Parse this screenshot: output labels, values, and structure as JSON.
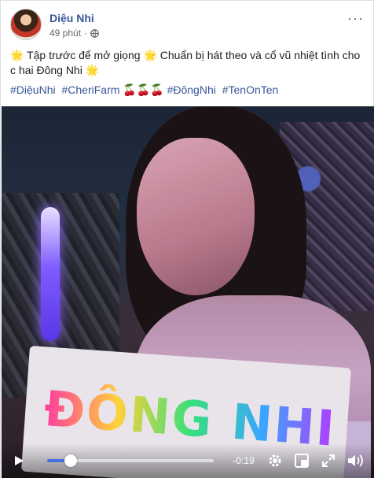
{
  "post": {
    "author": "Diệu Nhi",
    "time": "49 phút",
    "privacy_icon": "globe-icon",
    "more_label": "···",
    "text_line1": "Tập trước để mở giọng",
    "text_line2": "Chuẩn bị hát theo và cổ vũ nhiệt tình cho",
    "text_line3": "c hai Đông Nhi",
    "emoji_sun": "🌟",
    "hashtags": [
      "#DiệuNhi",
      "#CheriFarm",
      "#ĐôngNhi",
      "#TenOnTen"
    ],
    "cherries": "🍒🍒🍒"
  },
  "video": {
    "time_remaining": "-0:19",
    "progress": 0.14,
    "banner_text": "ĐÔNG NHI"
  }
}
